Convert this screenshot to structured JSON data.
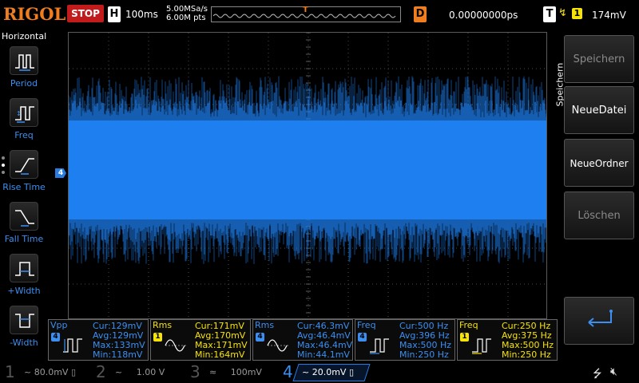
{
  "topbar": {
    "logo": "RIGOL",
    "run_state": "STOP",
    "h_key": "H",
    "timebase": "100ms",
    "sample_rate": "5.00MSa/s",
    "memory_depth": "6.00M pts",
    "d_key": "D",
    "delay": "0.00000000ps",
    "t_key": "T",
    "trigger_edge_glyph": "↯",
    "trigger_source": "1",
    "trigger_level": "174mV",
    "trigger_marker": "T"
  },
  "left_menu": {
    "title": "Horizontal",
    "items": [
      {
        "label": "Period",
        "icon": "period-icon"
      },
      {
        "label": "Freq",
        "icon": "freq-icon"
      },
      {
        "label": "Rise Time",
        "icon": "rise-time-icon"
      },
      {
        "label": "Fall Time",
        "icon": "fall-time-icon"
      },
      {
        "label": "+Width",
        "icon": "pos-width-icon"
      },
      {
        "label": "-Width",
        "icon": "neg-width-icon"
      }
    ]
  },
  "grid": {
    "ch4_marker": "4",
    "trace_color": "#1e7ff0"
  },
  "right_menu": {
    "title": "Speichern",
    "buttons": [
      {
        "label": "Speichern",
        "enabled": false
      },
      {
        "label": "NeueDatei",
        "enabled": true
      },
      {
        "label": "NeueOrdner",
        "enabled": true
      },
      {
        "label": "Löschen",
        "enabled": false
      }
    ],
    "back_icon": "return-arrow-icon"
  },
  "measurements": [
    {
      "name": "Vpp",
      "source": "4",
      "color": "blue",
      "cur": "Cur:129mV",
      "avg": "Avg:129mV",
      "max": "Max:133mV",
      "min": "Min:118mV"
    },
    {
      "name": "Rms",
      "source": "1",
      "color": "yellow",
      "cur": "Cur:171mV",
      "avg": "Avg:170mV",
      "max": "Max:171mV",
      "min": "Min:164mV"
    },
    {
      "name": "Rms",
      "source": "4",
      "color": "blue",
      "cur": "Cur:46.3mV",
      "avg": "Avg:46.4mV",
      "max": "Max:46.4mV",
      "min": "Min:44.1mV"
    },
    {
      "name": "Freq",
      "source": "4",
      "color": "blue",
      "cur": "Cur:500 Hz",
      "avg": "Avg:396 Hz",
      "max": "Max:500 Hz",
      "min": "Min:250 Hz"
    },
    {
      "name": "Freq",
      "source": "1",
      "color": "yellow",
      "cur": "Cur:250 Hz",
      "avg": "Avg:375 Hz",
      "max": "Max:500 Hz",
      "min": "Min:250 Hz"
    }
  ],
  "channels": [
    {
      "num": "1",
      "coupling": "~",
      "scale": "80.0mV",
      "suffix": "▯"
    },
    {
      "num": "2",
      "coupling": "~",
      "scale": "1.00 V",
      "suffix": ""
    },
    {
      "num": "3",
      "coupling": "≈",
      "scale": "100mV",
      "suffix": ""
    },
    {
      "num": "4",
      "coupling": "~",
      "scale": "20.0mV",
      "suffix": "▯"
    }
  ],
  "status_icons": {
    "usb": "usb-icon",
    "speaker": "speaker-muted-icon"
  },
  "colors": {
    "ch1": "#f5e30a",
    "ch4": "#3c8ff0",
    "accent": "#f07d1e",
    "stop": "#c21b1b"
  }
}
